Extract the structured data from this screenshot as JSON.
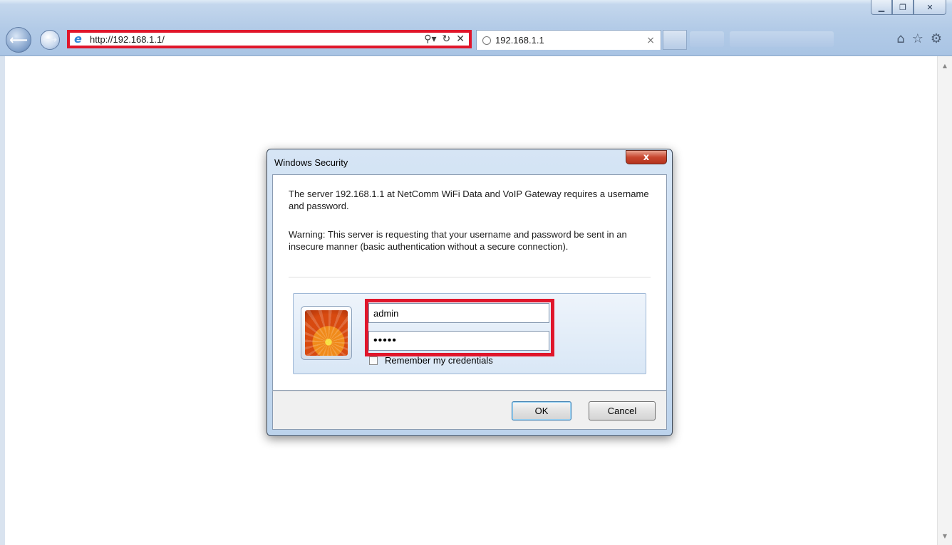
{
  "browser": {
    "address_url": "http://192.168.1.1/",
    "tab_title": "192.168.1.1",
    "icons": [
      "back-arrow-icon",
      "forward-arrow-icon",
      "ie-logo-icon",
      "search-icon",
      "refresh-icon",
      "stop-icon",
      "home-icon",
      "favorites-star-icon",
      "gear-icon"
    ]
  },
  "dialog": {
    "title": "Windows Security",
    "close_label": "x",
    "message": "The server 192.168.1.1 at NetComm WiFi Data and VoIP Gateway requires a username and password.",
    "warning": "Warning: This server is requesting that your username and password be sent in an insecure manner (basic authentication without a secure connection).",
    "username_value": "admin",
    "password_display": "•••••",
    "remember_label": "Remember my credentials",
    "remember_checked": false,
    "ok_label": "OK",
    "cancel_label": "Cancel"
  },
  "colors": {
    "highlight_red": "#e0162b",
    "chrome_blue": "#b3cbe7"
  }
}
